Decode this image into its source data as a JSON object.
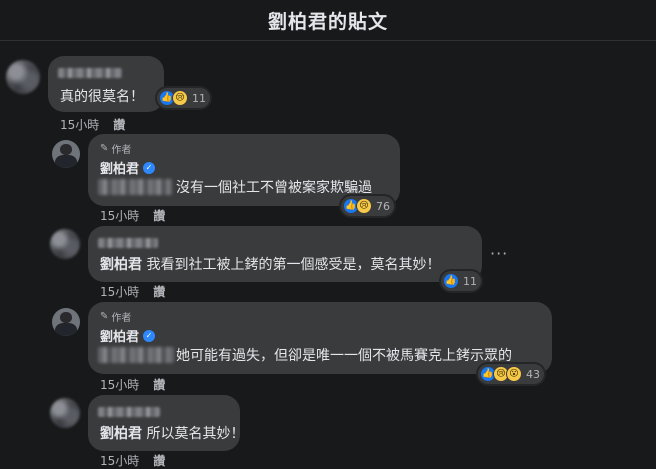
{
  "header": {
    "title": "劉柏君的貼文"
  },
  "comments": [
    {
      "text": "真的很莫名！",
      "reactions": {
        "icons": [
          "like-icon",
          "sad-icon"
        ],
        "count": "11"
      },
      "meta": {
        "time": "15小時",
        "reply": "讚"
      }
    },
    {
      "author_tag": "作者",
      "name": "劉柏君",
      "text": "沒有一個社工不曾被案家欺騙過",
      "reactions": {
        "icons": [
          "like-icon",
          "sad-icon"
        ],
        "count": "76"
      },
      "meta": {
        "time": "15小時",
        "reply": "讚"
      }
    },
    {
      "mention": "劉柏君",
      "text": "我看到社工被上銬的第一個感受是，莫名其妙！",
      "reactions": {
        "icons": [
          "like-icon"
        ],
        "count": "11"
      },
      "meta": {
        "time": "15小時",
        "reply": "讚"
      },
      "more": "···"
    },
    {
      "author_tag": "作者",
      "name": "劉柏君",
      "text": "她可能有過失，但卻是唯一一個不被馬賽克上銬示眾的",
      "reactions": {
        "icons": [
          "like-icon",
          "sad-icon",
          "wow-icon"
        ],
        "count": "43"
      },
      "meta": {
        "time": "15小時",
        "reply": "讚"
      }
    },
    {
      "mention": "劉柏君",
      "text": "所以莫名其妙！",
      "meta": {
        "time": "15小時",
        "reply": "讚"
      }
    }
  ],
  "icons": {
    "pencil": "✎",
    "check": "✓",
    "like": "👍",
    "sad": "😢",
    "wow": "😮"
  },
  "colors": {
    "background": "#18191a",
    "bubble": "#3a3b3c",
    "like": "#1877f2",
    "verified": "#2d88ff"
  }
}
